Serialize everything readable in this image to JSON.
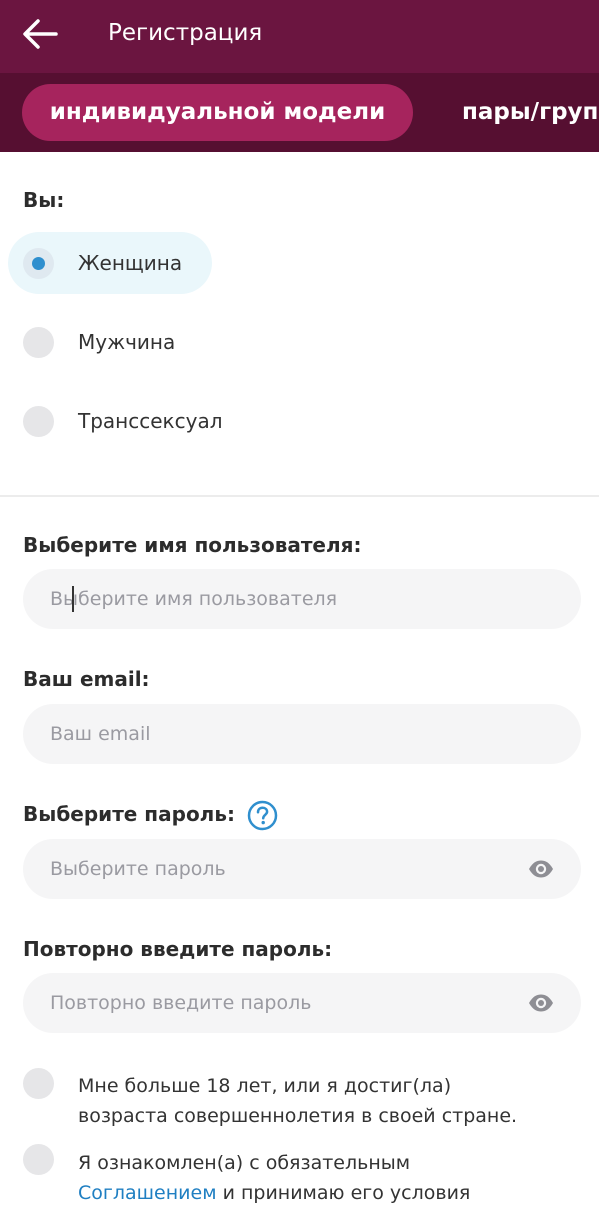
{
  "header": {
    "title": "Регистрация",
    "back_icon": "arrow-left-icon",
    "bg_color": "#6b1540"
  },
  "tabs": [
    {
      "label": "индивидуальной модели",
      "active": true
    },
    {
      "label": "пары/груп",
      "active": false
    }
  ],
  "gender": {
    "label": "Вы:",
    "options": [
      {
        "label": "Женщина",
        "selected": true
      },
      {
        "label": "Мужчина",
        "selected": false
      },
      {
        "label": "Транссексуал",
        "selected": false
      }
    ]
  },
  "username": {
    "label": "Выберите имя пользователя:",
    "placeholder": "Выберите имя пользователя",
    "value": ""
  },
  "email": {
    "label": "Ваш email:",
    "placeholder": "Ваш email",
    "value": ""
  },
  "password": {
    "label": "Выберите пароль:",
    "placeholder": "Выберите пароль",
    "help_icon": "question-circle-icon",
    "toggle_icon": "eye-icon"
  },
  "password_repeat": {
    "label": "Повторно введите пароль:",
    "placeholder": "Повторно введите пароль",
    "toggle_icon": "eye-icon"
  },
  "age_check": {
    "line1": "Мне больше 18 лет, или я достиг(ла)",
    "line2": "возраста совершеннолетия в своей стране.",
    "checked": false
  },
  "agreement_check": {
    "line1": "Я ознакомлен(а) с обязательным",
    "link": "Соглашением",
    "line2_rest": " и принимаю его условия",
    "checked": false
  },
  "colors": {
    "accent": "#a6245d",
    "link": "#1f7fc2",
    "radio_dot": "#2f8fce"
  }
}
